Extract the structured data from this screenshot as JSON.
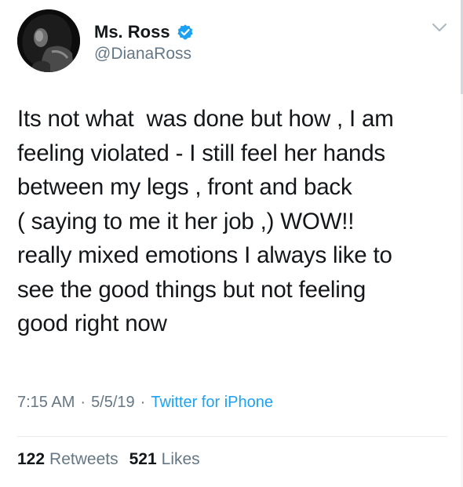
{
  "colors": {
    "accent": "#1da1f2",
    "text": "#14171a",
    "secondary": "#657786",
    "divider": "#e6ecf0"
  },
  "author": {
    "display_name": "Ms. Ross",
    "handle": "@DianaRoss",
    "verified_icon": "verified-badge-icon",
    "avatar_icon": "avatar-photo"
  },
  "menu_icon": "chevron-down-icon",
  "tweet": {
    "text": "Its not what  was done but how , I am\nfeeling violated - I still feel her hands\nbetween my legs , front and back\n( saying to me it her job ,) WOW!!\nreally mixed emotions I always like to\nsee the good things but not feeling\ngood right now"
  },
  "meta": {
    "time": "7:15 AM",
    "separator_1": "·",
    "date": "5/5/19",
    "separator_2": "·",
    "source": "Twitter for iPhone"
  },
  "stats": {
    "retweets_count": "122",
    "retweets_label": "Retweets",
    "likes_count": "521",
    "likes_label": "Likes"
  }
}
